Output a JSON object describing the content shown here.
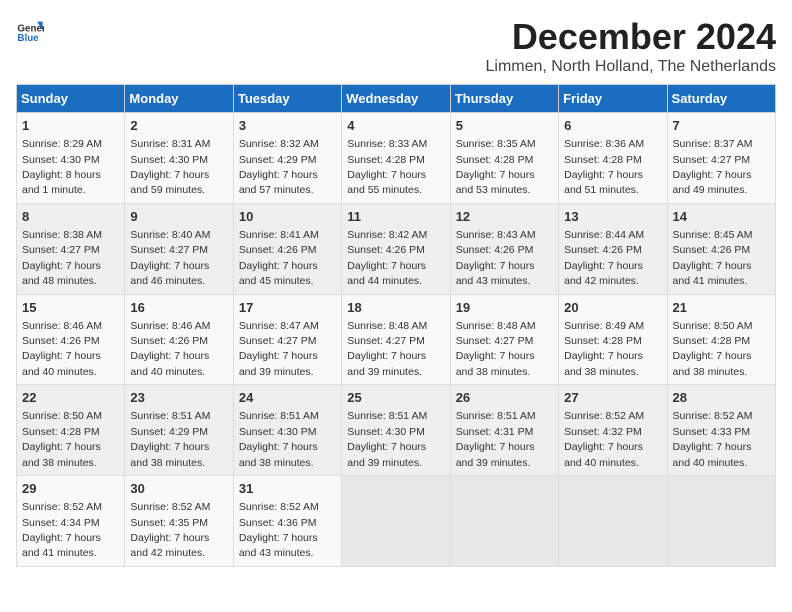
{
  "header": {
    "logo_general": "General",
    "logo_blue": "Blue",
    "title": "December 2024",
    "location": "Limmen, North Holland, The Netherlands"
  },
  "days_of_week": [
    "Sunday",
    "Monday",
    "Tuesday",
    "Wednesday",
    "Thursday",
    "Friday",
    "Saturday"
  ],
  "weeks": [
    [
      {
        "day": "1",
        "sunrise": "8:29 AM",
        "sunset": "4:30 PM",
        "daylight": "8 hours and 1 minute."
      },
      {
        "day": "2",
        "sunrise": "8:31 AM",
        "sunset": "4:30 PM",
        "daylight": "7 hours and 59 minutes."
      },
      {
        "day": "3",
        "sunrise": "8:32 AM",
        "sunset": "4:29 PM",
        "daylight": "7 hours and 57 minutes."
      },
      {
        "day": "4",
        "sunrise": "8:33 AM",
        "sunset": "4:28 PM",
        "daylight": "7 hours and 55 minutes."
      },
      {
        "day": "5",
        "sunrise": "8:35 AM",
        "sunset": "4:28 PM",
        "daylight": "7 hours and 53 minutes."
      },
      {
        "day": "6",
        "sunrise": "8:36 AM",
        "sunset": "4:28 PM",
        "daylight": "7 hours and 51 minutes."
      },
      {
        "day": "7",
        "sunrise": "8:37 AM",
        "sunset": "4:27 PM",
        "daylight": "7 hours and 49 minutes."
      }
    ],
    [
      {
        "day": "8",
        "sunrise": "8:38 AM",
        "sunset": "4:27 PM",
        "daylight": "7 hours and 48 minutes."
      },
      {
        "day": "9",
        "sunrise": "8:40 AM",
        "sunset": "4:27 PM",
        "daylight": "7 hours and 46 minutes."
      },
      {
        "day": "10",
        "sunrise": "8:41 AM",
        "sunset": "4:26 PM",
        "daylight": "7 hours and 45 minutes."
      },
      {
        "day": "11",
        "sunrise": "8:42 AM",
        "sunset": "4:26 PM",
        "daylight": "7 hours and 44 minutes."
      },
      {
        "day": "12",
        "sunrise": "8:43 AM",
        "sunset": "4:26 PM",
        "daylight": "7 hours and 43 minutes."
      },
      {
        "day": "13",
        "sunrise": "8:44 AM",
        "sunset": "4:26 PM",
        "daylight": "7 hours and 42 minutes."
      },
      {
        "day": "14",
        "sunrise": "8:45 AM",
        "sunset": "4:26 PM",
        "daylight": "7 hours and 41 minutes."
      }
    ],
    [
      {
        "day": "15",
        "sunrise": "8:46 AM",
        "sunset": "4:26 PM",
        "daylight": "7 hours and 40 minutes."
      },
      {
        "day": "16",
        "sunrise": "8:46 AM",
        "sunset": "4:26 PM",
        "daylight": "7 hours and 40 minutes."
      },
      {
        "day": "17",
        "sunrise": "8:47 AM",
        "sunset": "4:27 PM",
        "daylight": "7 hours and 39 minutes."
      },
      {
        "day": "18",
        "sunrise": "8:48 AM",
        "sunset": "4:27 PM",
        "daylight": "7 hours and 39 minutes."
      },
      {
        "day": "19",
        "sunrise": "8:48 AM",
        "sunset": "4:27 PM",
        "daylight": "7 hours and 38 minutes."
      },
      {
        "day": "20",
        "sunrise": "8:49 AM",
        "sunset": "4:28 PM",
        "daylight": "7 hours and 38 minutes."
      },
      {
        "day": "21",
        "sunrise": "8:50 AM",
        "sunset": "4:28 PM",
        "daylight": "7 hours and 38 minutes."
      }
    ],
    [
      {
        "day": "22",
        "sunrise": "8:50 AM",
        "sunset": "4:28 PM",
        "daylight": "7 hours and 38 minutes."
      },
      {
        "day": "23",
        "sunrise": "8:51 AM",
        "sunset": "4:29 PM",
        "daylight": "7 hours and 38 minutes."
      },
      {
        "day": "24",
        "sunrise": "8:51 AM",
        "sunset": "4:30 PM",
        "daylight": "7 hours and 38 minutes."
      },
      {
        "day": "25",
        "sunrise": "8:51 AM",
        "sunset": "4:30 PM",
        "daylight": "7 hours and 39 minutes."
      },
      {
        "day": "26",
        "sunrise": "8:51 AM",
        "sunset": "4:31 PM",
        "daylight": "7 hours and 39 minutes."
      },
      {
        "day": "27",
        "sunrise": "8:52 AM",
        "sunset": "4:32 PM",
        "daylight": "7 hours and 40 minutes."
      },
      {
        "day": "28",
        "sunrise": "8:52 AM",
        "sunset": "4:33 PM",
        "daylight": "7 hours and 40 minutes."
      }
    ],
    [
      {
        "day": "29",
        "sunrise": "8:52 AM",
        "sunset": "4:34 PM",
        "daylight": "7 hours and 41 minutes."
      },
      {
        "day": "30",
        "sunrise": "8:52 AM",
        "sunset": "4:35 PM",
        "daylight": "7 hours and 42 minutes."
      },
      {
        "day": "31",
        "sunrise": "8:52 AM",
        "sunset": "4:36 PM",
        "daylight": "7 hours and 43 minutes."
      },
      null,
      null,
      null,
      null
    ]
  ]
}
